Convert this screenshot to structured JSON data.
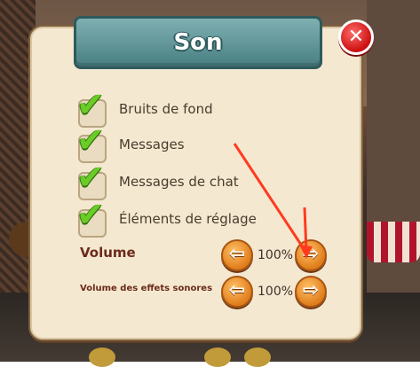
{
  "dialog": {
    "title": "Son",
    "close_icon": "close-icon"
  },
  "checkboxes": [
    {
      "label": "Bruits de fond",
      "checked": true
    },
    {
      "label": "Messages",
      "checked": true
    },
    {
      "label": "Messages de chat",
      "checked": true
    },
    {
      "label": "Éléments de réglage",
      "checked": true
    }
  ],
  "volume": {
    "label": "Volume",
    "value": "100%"
  },
  "effects_volume": {
    "label": "Volume des effets sonores",
    "value": "100%"
  },
  "colors": {
    "panel": "#f4e8d0",
    "title_tab": "#497f82",
    "check": "#6acc26",
    "arrow_button": "#e07d1b",
    "close_button": "#cc0f0f",
    "annotation_arrow": "#ff3b1f"
  }
}
